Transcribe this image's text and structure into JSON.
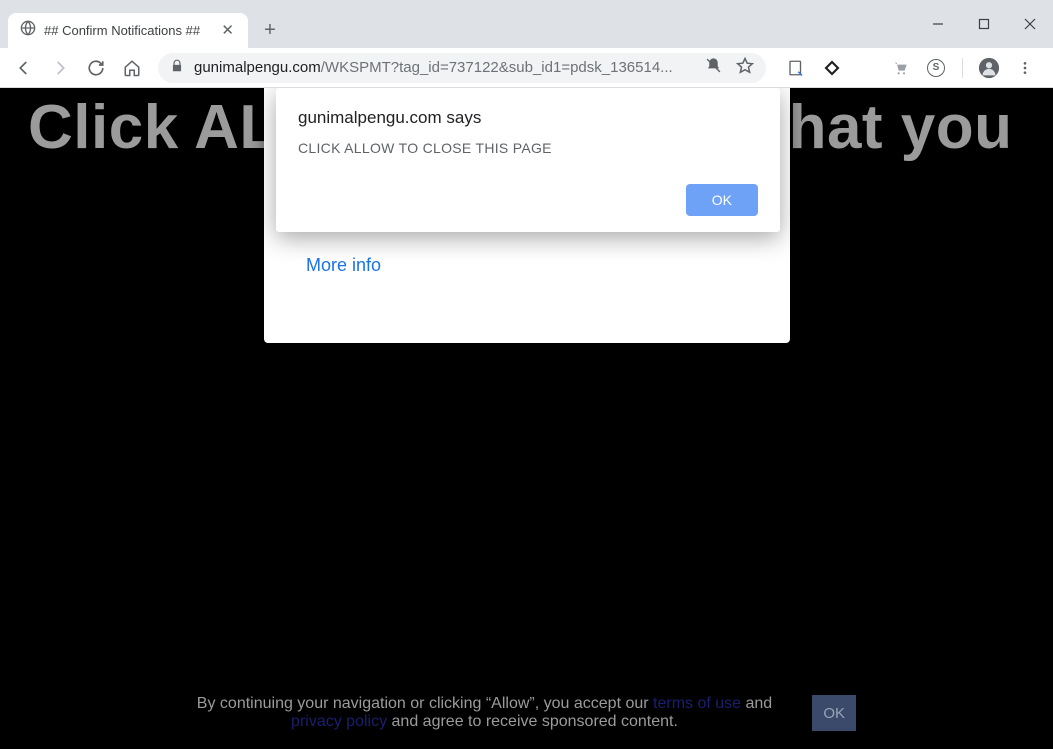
{
  "window": {
    "tab_title": "## Confirm Notifications ##"
  },
  "address": {
    "host": "gunimalpengu.com",
    "path": "/WKSPMT?tag_id=737122&sub_id1=pdsk_136514..."
  },
  "page": {
    "hero": "Click ALLOW to confirm that you",
    "more_info": "More info"
  },
  "alert": {
    "title": "gunimalpengu.com says",
    "message": "CLICK ALLOW TO CLOSE THIS PAGE",
    "ok": "OK"
  },
  "footer": {
    "before": "By continuing your navigation or clicking “Allow”, you accept our ",
    "terms": "terms of use",
    "mid": " and ",
    "privacy": "privacy policy",
    "after": " and agree to receive sponsored content.",
    "ok": "OK"
  }
}
